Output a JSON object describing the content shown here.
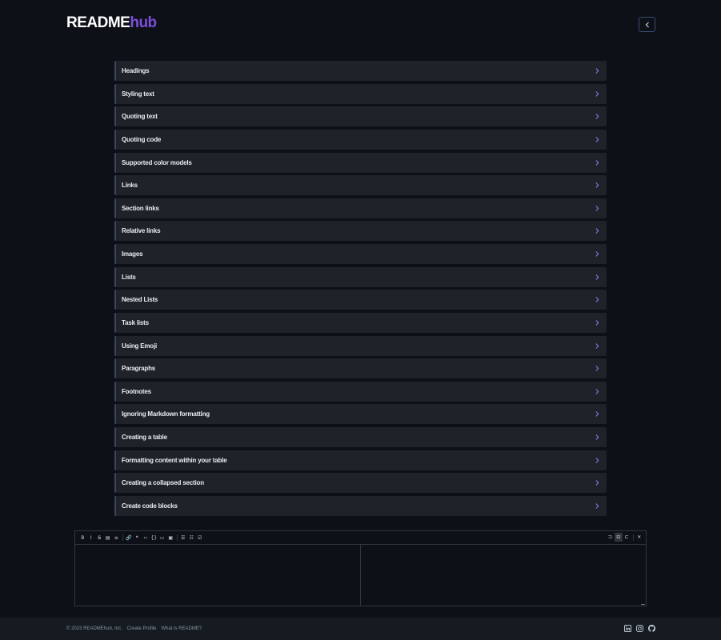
{
  "header": {
    "logo_main": "README",
    "logo_accent": "hub"
  },
  "sections": [
    "Headings",
    "Styling text",
    "Quoting text",
    "Quoting code",
    "Supported color models",
    "Links",
    "Section links",
    "Relative links",
    "Images",
    "Lists",
    "Nested Lists",
    "Task lists",
    "Using Emoji",
    "Paragraphs",
    "Footnotes",
    "Ignoring Markdown formatting",
    "Creating a table",
    "Formatting content within your table",
    "Creating a collapsed section",
    "Create code blocks"
  ],
  "editor": {
    "toolbar_left": [
      {
        "icon": "bold-icon",
        "glyph": "B"
      },
      {
        "icon": "italic-icon",
        "glyph": "I"
      },
      {
        "icon": "strikethrough-icon",
        "glyph": "S̶"
      },
      {
        "icon": "horizontal-rule-icon",
        "glyph": "▤"
      },
      {
        "icon": "title-icon",
        "glyph": "≡"
      },
      {
        "sep": true
      },
      {
        "icon": "link-icon",
        "glyph": "🔗"
      },
      {
        "icon": "quote-icon",
        "glyph": "❝"
      },
      {
        "icon": "code-icon",
        "glyph": "‹›"
      },
      {
        "icon": "code-block-icon",
        "glyph": "{}"
      },
      {
        "icon": "comment-icon",
        "glyph": "▭"
      },
      {
        "icon": "image-icon",
        "glyph": "▣"
      },
      {
        "sep": true
      },
      {
        "icon": "unordered-list-icon",
        "glyph": "☰"
      },
      {
        "icon": "ordered-list-icon",
        "glyph": "☷"
      },
      {
        "icon": "checked-list-icon",
        "glyph": "☑"
      }
    ],
    "toolbar_right": [
      {
        "icon": "edit-mode-icon",
        "glyph": "⊐"
      },
      {
        "icon": "live-mode-icon",
        "glyph": "⊟",
        "active": true
      },
      {
        "icon": "preview-mode-icon",
        "glyph": "⊏"
      },
      {
        "sep": true
      },
      {
        "icon": "fullscreen-icon",
        "glyph": "✕"
      }
    ]
  },
  "footer": {
    "copyright": "© 2023 READMEhub, Inc.",
    "links": [
      "Create Profile",
      "What is README?"
    ],
    "icons": [
      "linkedin-icon",
      "instagram-icon",
      "github-icon"
    ]
  },
  "colors": {
    "background": "#0d1117",
    "accent": "#7c4ddb",
    "chevron": "#6b7bd6",
    "section_bg": "#1f2329"
  }
}
